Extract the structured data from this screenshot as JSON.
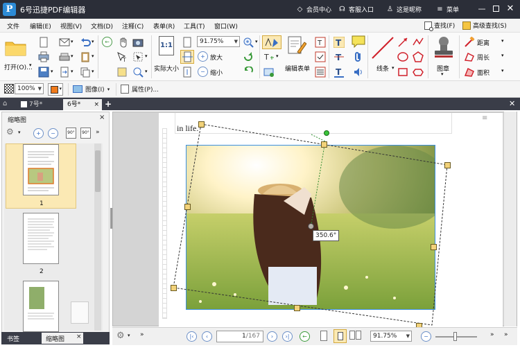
{
  "app": {
    "title": "6号迅捷PDF编辑器",
    "logo_letter": "P"
  },
  "titlebar": {
    "member_center": "会员中心",
    "customer_service": "客服入口",
    "nickname": "这是昵称",
    "menu": "菜单"
  },
  "menubar": {
    "items": [
      "文件",
      "编辑(E)",
      "视图(V)",
      "文档(D)",
      "注释(C)",
      "表单(R)",
      "工具(T)",
      "窗口(W)"
    ],
    "find": "查找(F)",
    "advanced_find": "高级查找(S)"
  },
  "ribbon": {
    "open": "打开(O)...",
    "actual_size": "实际大小",
    "zoom_value": "91.75%",
    "zoom_in": "放大",
    "zoom_out": "缩小",
    "edit_form": "编辑表单",
    "lines": "线条",
    "stamp": "图章",
    "distance": "距离",
    "perimeter": "周长",
    "area": "面积"
  },
  "toolbar2": {
    "zoom": "100%",
    "image": "图像(I)",
    "properties": "属性(P)..."
  },
  "tabs": [
    {
      "label": "7号",
      "modified": "*"
    },
    {
      "label": "6号",
      "modified": "*"
    }
  ],
  "left_panel": {
    "title": "缩略图",
    "pages": [
      "1",
      "2"
    ],
    "bottom_tabs": [
      "书签",
      "缩略图"
    ]
  },
  "document": {
    "text_line": "in life.  ”",
    "rotation_label": "350.6°"
  },
  "statusbar": {
    "page_current": "1",
    "page_total": "/167",
    "zoom": "91.75%"
  },
  "colors": {
    "accent": "#2c8bd6",
    "titlebar": "#2b2e38",
    "handle": "#f2d27a",
    "selection": "#3a8fe0"
  }
}
